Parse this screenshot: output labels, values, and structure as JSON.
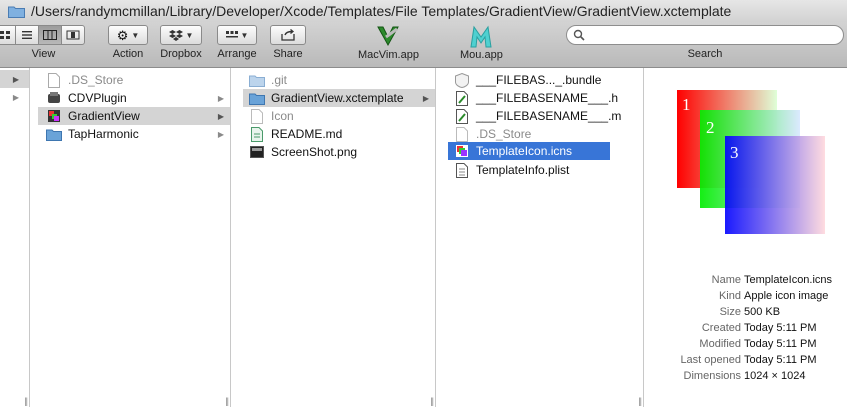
{
  "window": {
    "path": "/Users/randymcmillan/Library/Developer/Xcode/Templates/File Templates/GradientView/GradientView.xctemplate"
  },
  "toolbar": {
    "view_label": "View",
    "action_label": "Action",
    "dropbox_label": "Dropbox",
    "arrange_label": "Arrange",
    "share_label": "Share",
    "macvim_label": "MacVim.app",
    "mou_label": "Mou.app",
    "search_label": "Search",
    "search_value": ""
  },
  "column0": {
    "items": [
      {
        "label": ""
      },
      {
        "label": ""
      }
    ]
  },
  "column1": {
    "items": [
      {
        "label": ".DS_Store",
        "icon": "file-icon"
      },
      {
        "label": "CDVPlugin",
        "icon": "app-icon"
      },
      {
        "label": "GradientView",
        "icon": "color-folder-icon"
      },
      {
        "label": "TapHarmonic",
        "icon": "folder-icon"
      }
    ]
  },
  "column2": {
    "items": [
      {
        "label": ".git",
        "icon": "folder-icon"
      },
      {
        "label": "GradientView.xctemplate",
        "icon": "folder-icon"
      },
      {
        "label": "Icon",
        "icon": "file-icon"
      },
      {
        "label": "README.md",
        "icon": "text-file-icon"
      },
      {
        "label": "ScreenShot.png",
        "icon": "image-file-icon"
      }
    ]
  },
  "column3": {
    "items": [
      {
        "label": "___FILEBAS..._.bundle",
        "icon": "bundle-icon"
      },
      {
        "label": "___FILEBASENAME___.h",
        "icon": "header-file-icon"
      },
      {
        "label": "___FILEBASENAME___.m",
        "icon": "source-file-icon"
      },
      {
        "label": ".DS_Store",
        "icon": "file-icon"
      },
      {
        "label": "TemplateIcon.icns",
        "icon": "icns-file-icon"
      },
      {
        "label": "TemplateInfo.plist",
        "icon": "plist-file-icon"
      }
    ]
  },
  "preview": {
    "icon_numbers": [
      "1",
      "2",
      "3"
    ],
    "info": [
      {
        "key": "Name",
        "value": "TemplateIcon.icns"
      },
      {
        "key": "Kind",
        "value": "Apple icon image"
      },
      {
        "key": "Size",
        "value": "500 KB"
      },
      {
        "key": "Created",
        "value": "Today 5:11 PM"
      },
      {
        "key": "Modified",
        "value": "Today 5:11 PM"
      },
      {
        "key": "Last opened",
        "value": "Today 5:11 PM"
      },
      {
        "key": "Dimensions",
        "value": "1024 × 1024"
      }
    ]
  },
  "colors": {
    "selection_blue": "#3875d7",
    "selection_gray": "#d4d4d4",
    "folder_blue": "#6aa3d8"
  }
}
